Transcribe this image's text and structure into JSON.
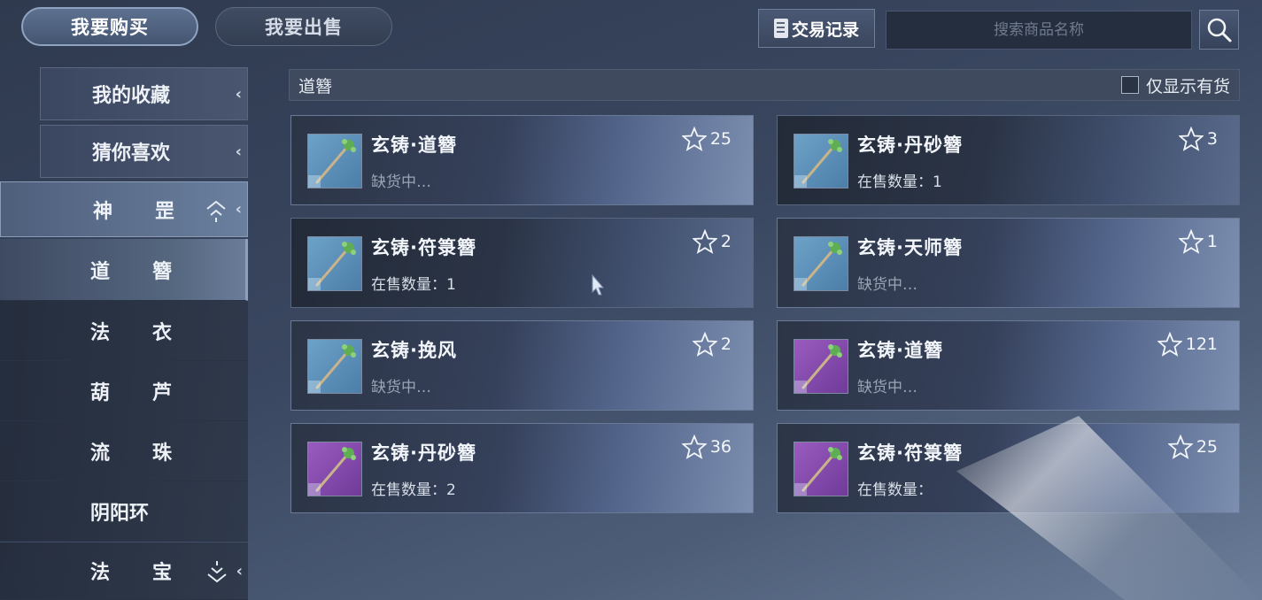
{
  "header": {
    "buy_label": "我要购买",
    "sell_label": "我要出售",
    "records_label": "交易记录",
    "search_placeholder": "搜索商品名称"
  },
  "sidebar": {
    "favorites_label": "我的收藏",
    "recommend_label": "猜你喜欢",
    "group_a": [
      "神",
      "罡"
    ],
    "categories": [
      {
        "c1": "道",
        "c2": "簪"
      },
      {
        "c1": "法",
        "c2": "衣"
      },
      {
        "c1": "葫",
        "c2": "芦"
      },
      {
        "c1": "流",
        "c2": "珠"
      },
      {
        "c1": "阴阳环",
        "c2": ""
      }
    ],
    "group_b": [
      "法",
      "宝"
    ]
  },
  "section": {
    "title": "道簪",
    "in_stock_label": "仅显示有货"
  },
  "items": [
    {
      "name": "玄铸·道簪",
      "status": "缺货中…",
      "fav_count": "25",
      "rarity": "blue"
    },
    {
      "name": "玄铸·丹砂簪",
      "status": "在售数量：1",
      "fav_count": "3",
      "rarity": "blue"
    },
    {
      "name": "玄铸·符箓簪",
      "status": "在售数量：1",
      "fav_count": "2",
      "rarity": "blue"
    },
    {
      "name": "玄铸·天师簪",
      "status": "缺货中…",
      "fav_count": "1",
      "rarity": "blue"
    },
    {
      "name": "玄铸·挽风",
      "status": "缺货中…",
      "fav_count": "2",
      "rarity": "blue"
    },
    {
      "name": "玄铸·道簪",
      "status": "缺货中…",
      "fav_count": "121",
      "rarity": "purple"
    },
    {
      "name": "玄铸·丹砂簪",
      "status": "在售数量：2",
      "fav_count": "36",
      "rarity": "purple"
    },
    {
      "name": "玄铸·符箓簪",
      "status": "在售数量：",
      "fav_count": "25",
      "rarity": "purple"
    }
  ]
}
